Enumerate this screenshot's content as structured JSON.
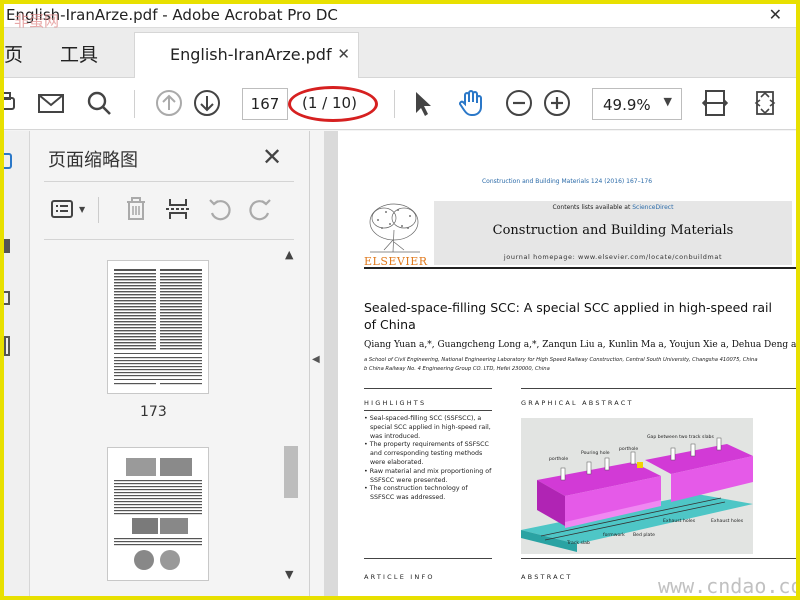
{
  "window": {
    "title": "English-IranArze.pdf - Adobe Acrobat Pro DC",
    "close_glyph": "✕"
  },
  "watermarks": {
    "top": "非蛋网",
    "bottom": "www.cndao.com"
  },
  "menu": {
    "home_label": "页",
    "tools_label": "工具"
  },
  "tab": {
    "label": "English-IranArze.pdf",
    "close_glyph": "✕"
  },
  "toolbar": {
    "icons": [
      "print-icon",
      "email-icon",
      "search-icon",
      "page-up-icon",
      "page-down-icon",
      "select-cursor-icon",
      "hand-tool-icon",
      "zoom-out-icon",
      "zoom-in-icon",
      "fit-page-icon",
      "full-screen-icon"
    ],
    "page_current": "167",
    "page_count": "(1 / 10)",
    "zoom_value": "49.9%",
    "zoom_caret": "▼"
  },
  "thumbnails_panel": {
    "title": "页面缩略图",
    "close_glyph": "✕",
    "tools": [
      "thumbnail-options-icon",
      "delete-page-icon",
      "insert-page-icon",
      "rotate-ccw-icon",
      "rotate-cw-icon"
    ],
    "pages": [
      {
        "label": "173"
      }
    ],
    "scroll_up": "▲",
    "scroll_down": "▼",
    "collapse_arrow": "◀"
  },
  "document": {
    "journal_ref": "Construction and Building Materials 124 (2016) 167–176",
    "contents_prefix": "Contents lists available at ",
    "contents_link": "ScienceDirect",
    "journal_name": "Construction and Building Materials",
    "journal_homepage": "journal homepage: www.elsevier.com/locate/conbuildmat",
    "publisher": "ELSEVIER",
    "title": "Sealed-space-filling SCC: A special SCC applied in high-speed rail of China",
    "authors": "Qiang Yuan a,*, Guangcheng Long a,*, Zanqun Liu a, Kunlin Ma a, Youjun Xie a, Dehua Deng a, H",
    "affiliation_a": "a School of Civil Engineering, National Engineering Laboratory for High Speed Railway Construction, Central South University, Changsha 410075, China",
    "affiliation_b": "b China Railway No. 4 Engineering Group CO. LTD, Hefei 230000, China",
    "highlights_head": "HIGHLIGHTS",
    "highlights": [
      "Seal-spaced-filling SCC (SSFSCC), a special SCC applied in high-speed rail, was introduced.",
      "The property requirements of SSFSCC and corresponding testing methods were elaborated.",
      "Raw material and mix proportioning of SSFSCC were presented.",
      "The construction technology of SSFSCC was addressed."
    ],
    "graphical_abstract_head": "GRAPHICAL ABSTRACT",
    "ga_labels": {
      "gap": "Gap between two track slabs",
      "porthole1": "porthole",
      "pouring": "Pouring hole",
      "porthole2": "porthole",
      "exhaust1": "Exhaust holes",
      "exhaust2": "Exhaust holes",
      "track": "Track slab",
      "formwork": "formwork",
      "bed": "Bed plate"
    },
    "article_info_head": "ARTICLE INFO",
    "abstract_head": "ABSTRACT"
  },
  "colors": {
    "frame": "#e8e000",
    "annotation": "#d62020",
    "link": "#2a6aa8",
    "elsevier_orange": "#e07a1e",
    "slab_magenta": "#d23ad6",
    "rail_teal": "#4ec6c6"
  }
}
